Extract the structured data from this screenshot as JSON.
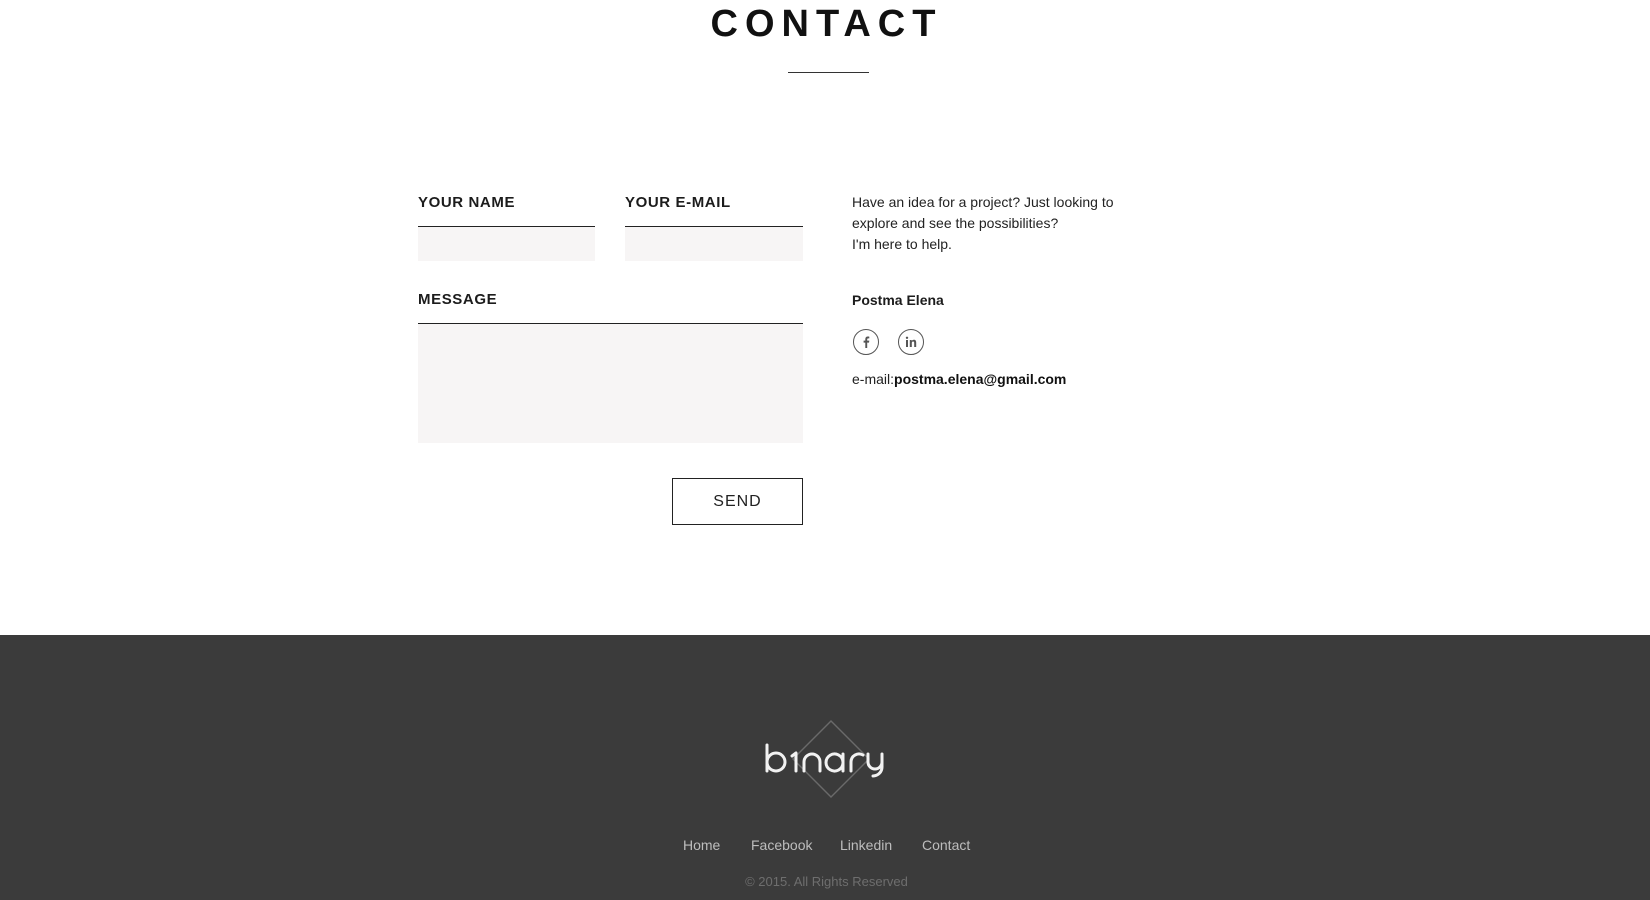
{
  "header": {
    "title": "CONTACT"
  },
  "form": {
    "name_label": "YOUR NAME",
    "name_value": "",
    "email_label": "YOUR E-MAIL",
    "email_value": "",
    "message_label": "MESSAGE",
    "message_value": "",
    "send_label": "SEND"
  },
  "info": {
    "intro_lines": [
      "Have an idea for a project? Just looking to",
      "explore and see the possibilities?",
      "I'm here to help."
    ],
    "name": "Postma Elena",
    "social": [
      {
        "icon": "facebook-icon",
        "glyph": "f"
      },
      {
        "icon": "linkedin-icon",
        "glyph": "in"
      }
    ],
    "email_prefix": "e-mail:",
    "email": "postma.elena@gmail.com"
  },
  "footer": {
    "logo_text": "binary",
    "nav": [
      "Home",
      "Facebook",
      "Linkedin",
      "Contact"
    ],
    "copyright": "© 2015. All Rights Reserved"
  },
  "colors": {
    "footer_bg": "#3b3b3b",
    "field_bg": "#f7f5f5",
    "text": "#222222",
    "footer_link": "#bdbdbd"
  }
}
